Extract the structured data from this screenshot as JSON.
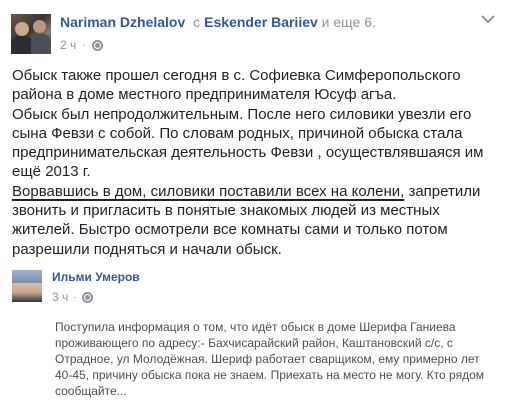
{
  "post": {
    "author": "Nariman Dzhelalov",
    "with_word": "с",
    "with_name": "Eskender Bariiev",
    "and_more": "и еще 6.",
    "time": "2 ч",
    "dot": "·",
    "paragraphs": [
      "Обыск также прошел сегодня в с. Софиевка Симферопольского района в доме местного предпринимателя Юсуф агъа.",
      "Обыск был непродолжительным. После него силовики увезли его сына Февзи с собой. По словам родных, причиной обыска стала предпринимательская деятельность Февзи , осуществлявшаяся им ещё 2013 г."
    ],
    "underlined_text": "Ворвавшись в дом, силовики поставили всех на колени,",
    "after_underline": " запретили звонить и пригласить в понятые знакомых людей из местных жителей. Быстро осмотрели все комнаты сами и только потом разрешили подняться и начали обыск."
  },
  "shared": {
    "author": "Ильми Умеров",
    "time": "3 ч",
    "dot": "·",
    "text": "Поступила информация о том, что идёт обыск в доме Шерифа Ганиева проживающего по адресу:- Бахчисарайский район, Каштановский с/с, с Отрадное, ул Молодёжная. Шериф работает сварщиком, ему примерно лет 40-45, причину обыска пока не знаем. Приехать на место не могу. Кто рядом сообщайте..."
  }
}
